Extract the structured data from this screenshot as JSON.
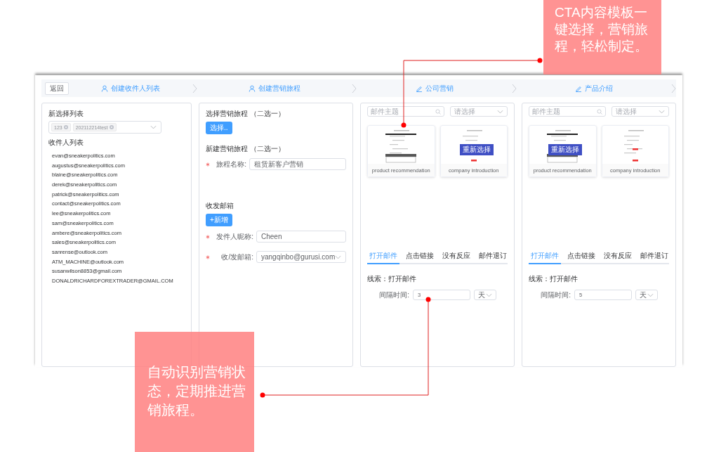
{
  "back_button": "返回",
  "steps": [
    {
      "label": "创建收件人列表"
    },
    {
      "label": "创建营销旅程"
    },
    {
      "label": "公司营销"
    },
    {
      "label": "产品介绍"
    }
  ],
  "recipients": {
    "list_label": "新选择列表",
    "tags": [
      "123",
      "202112214test"
    ],
    "title": "收件人列表",
    "emails": [
      "evan@sneakerpolitics.com",
      "augustus@sneakerpolitics.com",
      "blaine@sneakerpolitics.com",
      "derek@sneakerpolitics.com",
      "patrick@sneakerpolitics.com",
      "contact@sneakerpolitics.com",
      "lee@sneakerpolitics.com",
      "sam@sneakerpolitics.com",
      "ambere@sneakerpolitics.com",
      "sales@sneakerpolitics.com",
      "sanrense@outlook.com",
      "ATM_MACHINE@outlook.com",
      "susanwilson8853@gmail.com",
      "DONALDRICHARDFOREXTRADER@GMAIL.COM"
    ]
  },
  "journey": {
    "select_title": "选择营销旅程 （二选一）",
    "select_button": "选择..",
    "new_title": "新建营销旅程 （二选一）",
    "fields_top": [
      {
        "label": "旅程名称:",
        "value": "租赁新客户营销",
        "required": true,
        "dropdown": false
      }
    ],
    "mailbox_title": "收发邮箱",
    "add_button": "+新增",
    "fields_bottom": [
      {
        "label": "发件人昵称:",
        "value": "Cheen",
        "required": true,
        "dropdown": false
      },
      {
        "label": "收/发邮箱:",
        "value": "yangqinbo@gurusi.com",
        "required": true,
        "dropdown": true
      }
    ]
  },
  "stages": [
    {
      "search_placeholder": "邮件主题",
      "select_placeholder": "请选择",
      "templates": [
        {
          "name": "product recommendation"
        },
        {
          "name": "company introduction",
          "reselect_button": "重新选择"
        }
      ],
      "tabs": [
        {
          "label": "打开邮件",
          "selected": true
        },
        {
          "label": "点击链接",
          "selected": false
        },
        {
          "label": "没有反应",
          "selected": false
        },
        {
          "label": "邮件退订",
          "selected": false
        }
      ],
      "condition": "线索：打开邮件",
      "interval_label": "间隔时间:",
      "interval_value": "3",
      "unit": "天"
    },
    {
      "search_placeholder": "邮件主题",
      "select_placeholder": "请选择",
      "templates": [
        {
          "name": "product recommendation",
          "reselect_button": "重新选择"
        },
        {
          "name": "company introduction"
        }
      ],
      "tabs": [
        {
          "label": "打开邮件",
          "selected": true
        },
        {
          "label": "点击链接",
          "selected": false
        },
        {
          "label": "没有反应",
          "selected": false
        },
        {
          "label": "邮件退订",
          "selected": false
        }
      ],
      "condition": "线索：打开邮件",
      "interval_label": "间隔时间:",
      "interval_value": "5",
      "unit": "天"
    }
  ],
  "callouts": [
    "CTA内容模板一键选择，营销旅程，轻松制定。",
    "自动识别营销状态，定期推进营销旅程。"
  ]
}
